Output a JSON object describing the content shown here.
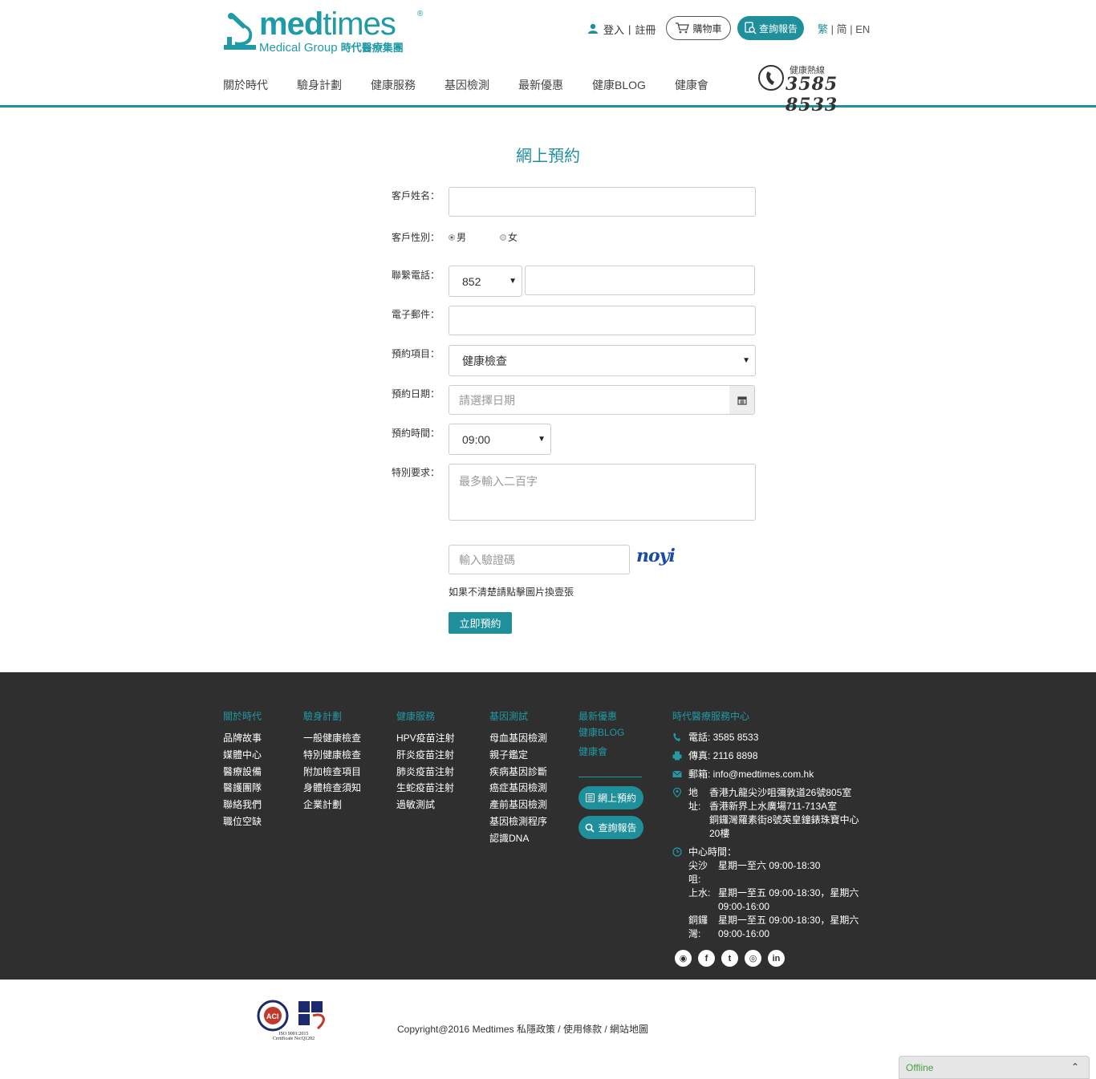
{
  "header": {
    "logo": {
      "brand_bold": "med",
      "brand_thin": "times",
      "registered": "®",
      "sub_en": "Medical Group",
      "sub_zh": "時代醫療集團"
    },
    "login": "登入",
    "register": "註冊",
    "cart": "購物車",
    "report": "查詢報告",
    "langs": {
      "trad": "繁",
      "simp": "简",
      "en": "EN"
    },
    "nav": [
      "關於時代",
      "驗身計劃",
      "健康服務",
      "基因檢測",
      "最新優惠",
      "健康BLOG",
      "健康會"
    ],
    "hotline_label": "健康熱線",
    "hotline_number": "3585 8533"
  },
  "form": {
    "title": "網上預約",
    "name_label": "客戶姓名：",
    "name_value": "",
    "gender_label": "客戶性別：",
    "gender_male": "男",
    "gender_female": "女",
    "phone_label": "聯繫電話：",
    "phone_code": "852",
    "phone_value": "",
    "email_label": "電子郵件：",
    "email_value": "",
    "item_label": "預約項目：",
    "item_value": "健康檢查",
    "date_label": "預約日期：",
    "date_placeholder": "請選擇日期",
    "time_label": "預約時間：",
    "time_value": "09:00",
    "request_label": "特別要求：",
    "request_placeholder": "最多輸入二百字",
    "captcha_placeholder": "輸入驗證碼",
    "captcha_text": "noyi",
    "captcha_hint": "如果不清楚請點擊圖片換壹張",
    "submit": "立即預約"
  },
  "footer": {
    "cols": [
      {
        "head": "關於時代",
        "items": [
          "品牌故事",
          "媒體中心",
          "醫療設備",
          "醫護團隊",
          "聯絡我們",
          "職位空缺"
        ]
      },
      {
        "head": "驗身計劃",
        "items": [
          "一般健康檢查",
          "特別健康檢查",
          "附加檢查項目",
          "身體檢查須知",
          "企業計劃"
        ]
      },
      {
        "head": "健康服務",
        "items": [
          "HPV疫苗注射",
          "肝炎疫苗注射",
          "肺炎疫苗注射",
          "生蛇疫苗注射",
          "過敏測試"
        ]
      },
      {
        "head": "基因測試",
        "items": [
          "母血基因檢測",
          "親子鑑定",
          "疾病基因診斷",
          "癌症基因檢測",
          "產前基因檢測",
          "基因檢測程序",
          "認識DNA"
        ]
      },
      {
        "head": "最新優惠",
        "items": [
          "健康BLOG",
          "健康會"
        ]
      }
    ],
    "btn_booking": "網上預約",
    "btn_report": "查詢報告",
    "center_head": "時代醫療服務中心",
    "phone": "電話: 3585 8533",
    "fax": "傳真: 2116 8898",
    "email": "郵箱: info@medtimes.com.hk",
    "addr_label": "地址:",
    "addresses": [
      "香港九龍尖沙咀彌敦道26號805室",
      "香港新界上水廣場711-713A室",
      "銅鑼灣羅素街8號英皇鐘錶珠寶中心20樓"
    ],
    "hours_label": "中心時間：",
    "hours": [
      {
        "k": "尖沙咀:",
        "v": "星期一至六 09:00-18:30"
      },
      {
        "k": "上水:",
        "v": "星期一至五 09:00-18:30，星期六 09:00-16:00"
      },
      {
        "k": "銅鑼灣:",
        "v": "星期一至五 09:00-18:30，星期六 09:00-16:00"
      }
    ],
    "socials": [
      "wechat-icon",
      "facebook-icon",
      "twitter-icon",
      "instagram-icon",
      "linkedin-icon"
    ]
  },
  "bottom": {
    "cert_iso": "ISO 9001:2015",
    "cert_no": "Certificate No:Q1202",
    "copyright": "Copyright@2016 Medtimes",
    "privacy": "私隱政策",
    "terms": "使用條款",
    "sitemap": "網站地圖",
    "offline": "Offline"
  },
  "colors": {
    "accent": "#1f8f9b",
    "footer_bg": "#2f2f2f"
  }
}
